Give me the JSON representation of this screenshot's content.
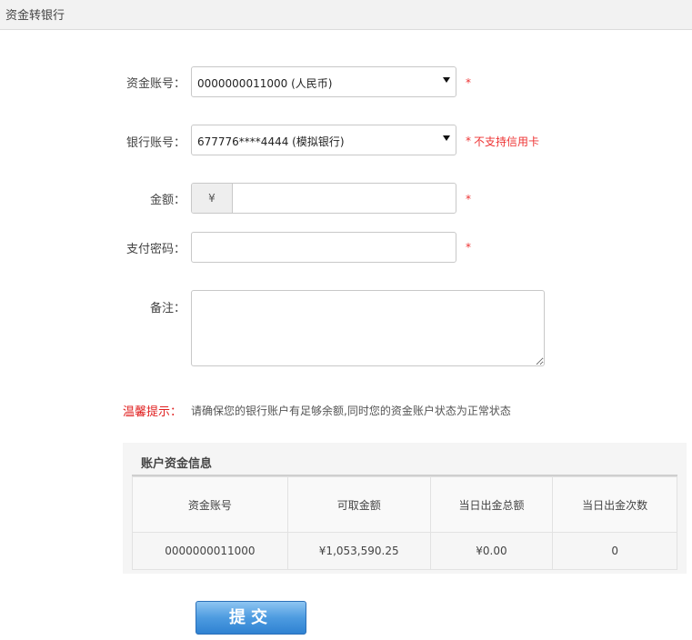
{
  "page": {
    "title": "资金转银行"
  },
  "form": {
    "fund_account": {
      "label": "资金账号：",
      "value": "0000000011000 (人民币)",
      "required_mark": "*"
    },
    "bank_account": {
      "label": "银行账号：",
      "value": "677776****4444 (模拟银行)",
      "required_mark": "*",
      "hint": "不支持信用卡"
    },
    "amount": {
      "label": "金额：",
      "prefix": "¥",
      "value": "",
      "required_mark": "*"
    },
    "password": {
      "label": "支付密码：",
      "value": "",
      "required_mark": "*"
    },
    "remark": {
      "label": "备注：",
      "value": ""
    }
  },
  "tip": {
    "label": "温馨提示：",
    "text": "请确保您的银行账户有足够余额,同时您的资金账户状态为正常状态"
  },
  "account_info": {
    "title": "账户资金信息",
    "headers": [
      "资金账号",
      "可取金额",
      "当日出金总额",
      "当日出金次数"
    ],
    "row": [
      "0000000011000",
      "¥1,053,590.25",
      "¥0.00",
      "0"
    ]
  },
  "submit_label": "提交",
  "colors": {
    "required": "#e33333",
    "tip_label": "#e02020",
    "button": "#4d9be0"
  }
}
